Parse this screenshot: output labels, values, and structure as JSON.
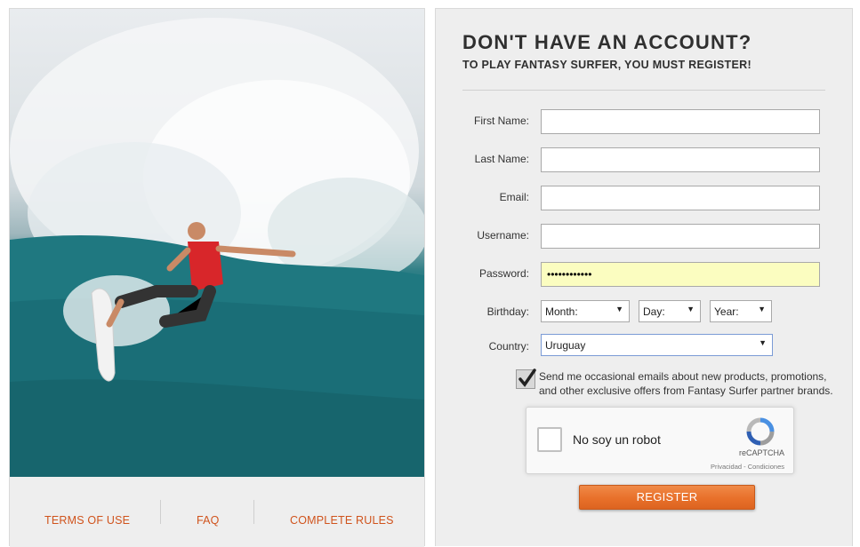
{
  "hero": {
    "image": "surfer-photo"
  },
  "footer": {
    "terms_label": "TERMS OF USE",
    "faq_label": "FAQ",
    "rules_label": "COMPLETE RULES"
  },
  "form": {
    "heading": "DON'T HAVE AN ACCOUNT?",
    "subheading": "TO PLAY FANTASY SURFER, YOU MUST REGISTER!",
    "first_name_label": "First Name:",
    "last_name_label": "Last Name:",
    "email_label": "Email:",
    "username_label": "Username:",
    "password_label": "Password:",
    "password_value": "••••••••••••",
    "birthday_label": "Birthday:",
    "month_value": "Month:",
    "day_value": "Day:",
    "year_value": "Year:",
    "country_label": "Country:",
    "country_value": "Uruguay",
    "optin_checked": true,
    "optin_text": "Send me occasional emails about new products, promotions, and other exclusive offers from Fantasy Surfer partner brands.",
    "register_label": "REGISTER"
  },
  "recaptcha": {
    "label": "No soy un robot",
    "brand": "reCAPTCHA",
    "terms": "Privacidad - Condiciones"
  },
  "colors": {
    "accent": "#e8702a",
    "link": "#d0531c",
    "autofill": "#fbfdc0"
  }
}
